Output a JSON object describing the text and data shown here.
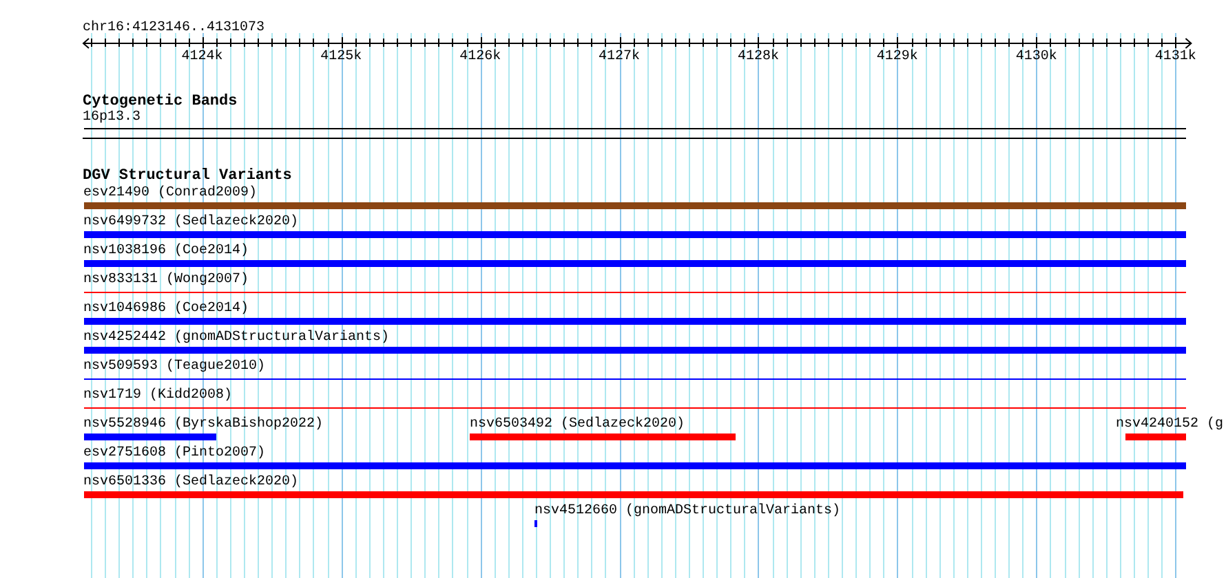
{
  "ruler": {
    "location": "chr16:4123146..4131073",
    "ticks": [
      "4124k",
      "4125k",
      "4126k",
      "4127k",
      "4128k",
      "4129k",
      "4130k",
      "4131k"
    ]
  },
  "cytogenetic_bands": {
    "title": "Cytogenetic Bands",
    "band": "16p13.3"
  },
  "structural_variants": {
    "title": "DGV Structural Variants",
    "variants": [
      {
        "label": "esv21490 (Conrad2009)",
        "kind": "thick",
        "color": "#8b4513"
      },
      {
        "label": "nsv6499732 (Sedlazeck2020)",
        "kind": "thick",
        "color": "#0000ff"
      },
      {
        "label": "nsv1038196 (Coe2014)",
        "kind": "thick",
        "color": "#0000ff"
      },
      {
        "label": "nsv833131 (Wong2007)",
        "kind": "thin",
        "color": "#ff0000"
      },
      {
        "label": "nsv1046986 (Coe2014)",
        "kind": "thick",
        "color": "#0000ff"
      },
      {
        "label": "nsv4252442 (gnomADStructuralVariants)",
        "kind": "thick",
        "color": "#0000ff"
      },
      {
        "label": "nsv509593 (Teague2010)",
        "kind": "thin",
        "color": "#0000ff"
      },
      {
        "label": "nsv1719 (Kidd2008)",
        "kind": "thin",
        "color": "#ff0000"
      },
      {
        "label": "nsv5528946 (ByrskaBishop2022)",
        "kind": "thick",
        "color": "#0000ff"
      },
      {
        "label": "nsv6503492 (Sedlazeck2020)",
        "kind": "thick",
        "color": "#ff0000"
      },
      {
        "label": "nsv4240152 (g",
        "kind": "thick",
        "color": "#ff0000"
      },
      {
        "label": "esv2751608 (Pinto2007)",
        "kind": "thick",
        "color": "#0000ff"
      },
      {
        "label": "nsv6501336 (Sedlazeck2020)",
        "kind": "thick",
        "color": "#ff0000"
      },
      {
        "label": "nsv4512660 (gnomADStructuralVariants)",
        "kind": "thick",
        "color": "#0000ff"
      }
    ]
  }
}
